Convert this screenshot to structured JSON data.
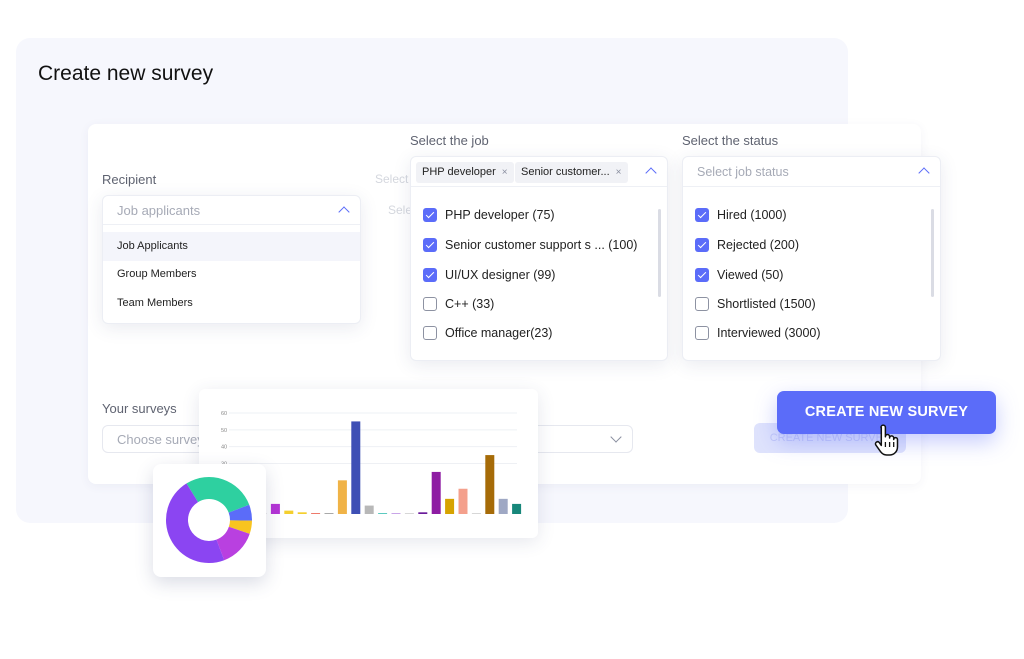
{
  "page": {
    "title": "Create new survey"
  },
  "recipient": {
    "label": "Recipient",
    "placeholder": "Job applicants",
    "options": [
      "Job Applicants",
      "Group Members",
      "Team Members"
    ],
    "active_index": 0
  },
  "job": {
    "label": "Select the job",
    "tags": [
      "PHP developer",
      "Senior customer..."
    ],
    "tag_remove": "×",
    "options": [
      {
        "label": "PHP developer (75)",
        "checked": true
      },
      {
        "label": "Senior customer support s ... (100)",
        "checked": true
      },
      {
        "label": "UI/UX designer (99)",
        "checked": true
      },
      {
        "label": "C++ (33)",
        "checked": false
      },
      {
        "label": "Office manager(23)",
        "checked": false
      }
    ]
  },
  "status": {
    "label": "Select the status",
    "placeholder": "Select job status",
    "options": [
      {
        "label": "Hired (1000)",
        "checked": true
      },
      {
        "label": "Rejected (200)",
        "checked": true
      },
      {
        "label": "Viewed (50)",
        "checked": true
      },
      {
        "label": "Shortlisted (1500)",
        "checked": false
      },
      {
        "label": "Interviewed (3000)",
        "checked": false
      }
    ]
  },
  "surveys": {
    "label": "Your surveys",
    "placeholder": "Choose survey"
  },
  "background_hints": {
    "select_1": "Select",
    "select_2": "Select"
  },
  "actions": {
    "create_label": "CREATE NEW SURVEY",
    "create_ghost_label": "CREATE NEW SURVEY"
  },
  "colors": {
    "accent": "#5b6cf9",
    "panel_bg": "#f6f7fd"
  },
  "icons": {
    "cursor": "hand-pointer-icon"
  },
  "chart_data": [
    {
      "type": "bar",
      "y_ticks": [
        "60",
        "50",
        "40",
        "30"
      ],
      "ylim": [
        0,
        60
      ],
      "grid": true,
      "values": [
        0,
        6,
        2,
        1,
        0.5,
        0.5,
        20,
        55,
        5,
        0.5,
        0.5,
        0.5,
        1,
        25,
        9,
        15,
        0.5,
        35,
        9,
        6
      ],
      "colors": [
        "#d7d7d7",
        "#b535d6",
        "#f4cf2e",
        "#f4cf2e",
        "#ee7a6b",
        "#a9a9a9",
        "#f0b347",
        "#3e4fb5",
        "#b8b8b8",
        "#5ccac0",
        "#c9a5e8",
        "#d7d7d7",
        "#6a1b9a",
        "#8e1ca3",
        "#d6a300",
        "#f4a08c",
        "#d7d7d7",
        "#a66b08",
        "#9fa8c4",
        "#17877a"
      ]
    },
    {
      "type": "pie",
      "donut": true,
      "values": [
        28,
        6,
        5,
        14,
        47
      ],
      "colors": [
        "#2ed0a0",
        "#5b6cf9",
        "#f8c420",
        "#b940e0",
        "#8b45f2"
      ]
    }
  ]
}
